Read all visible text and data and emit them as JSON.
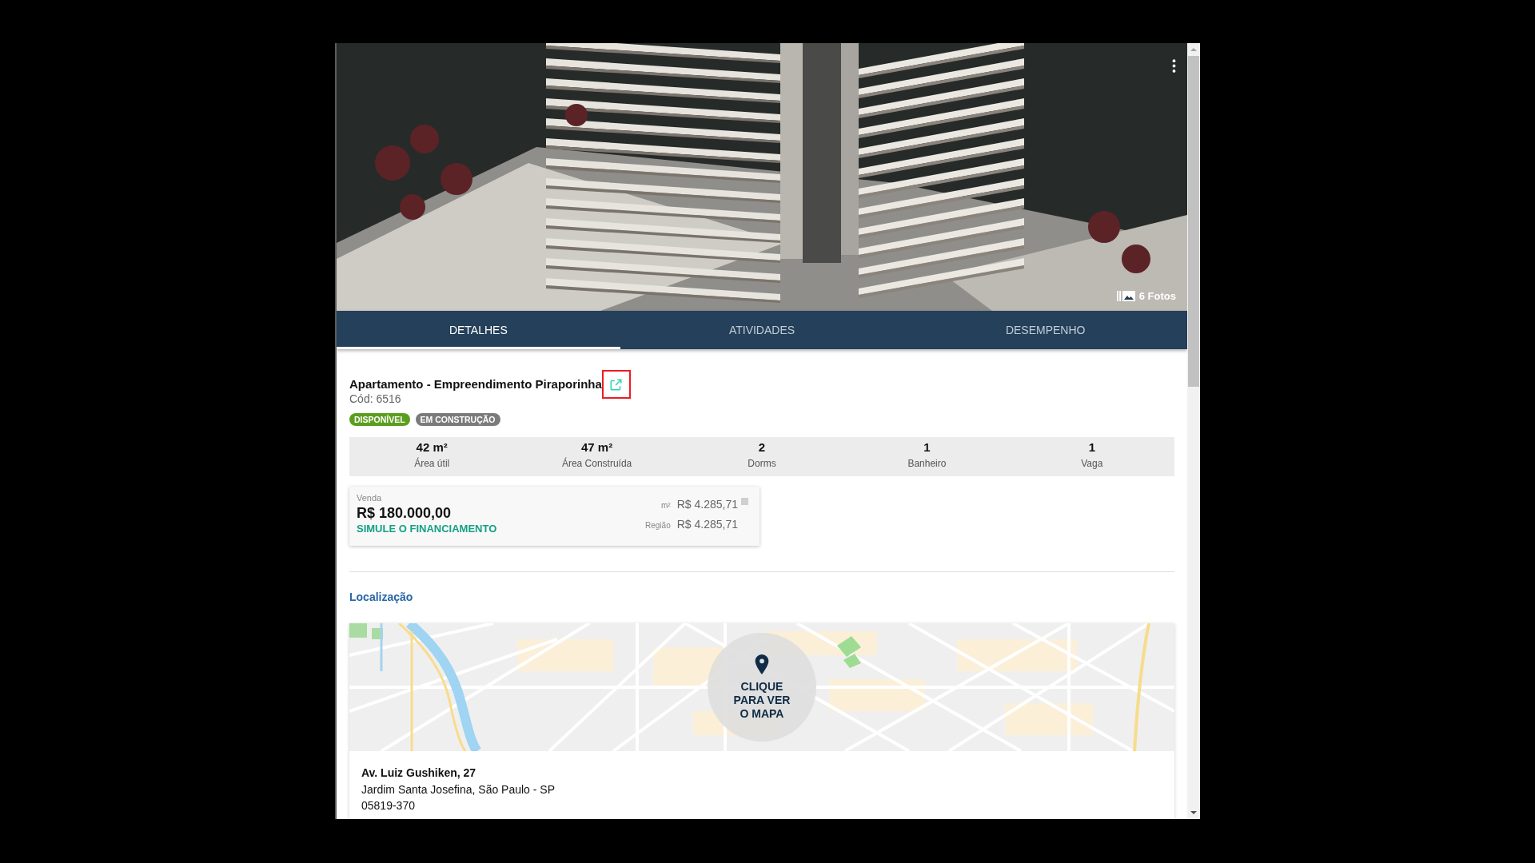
{
  "photo": {
    "count_label": "6 Fotos"
  },
  "tabs": [
    {
      "label": "DETALHES",
      "selected": true
    },
    {
      "label": "ATIVIDADES",
      "selected": false
    },
    {
      "label": "DESEMPENHO",
      "selected": false
    }
  ],
  "listing": {
    "title": "Apartamento - Empreendimento Piraporinha",
    "link_highlighted": true,
    "code": "Cód: 6516",
    "badges": [
      {
        "label": "DISPONÍVEL",
        "color": "#5b9e1f"
      },
      {
        "label": "EM CONSTRUÇÃO",
        "color": "#7b7b7b"
      }
    ]
  },
  "stats": [
    {
      "value": "42 m²",
      "label": "Área útil"
    },
    {
      "value": "47 m²",
      "label": "Área Construída"
    },
    {
      "value": "2",
      "label": "Dorms"
    },
    {
      "value": "1",
      "label": "Banheiro"
    },
    {
      "value": "1",
      "label": "Vaga"
    }
  ],
  "price": {
    "type_label": "Venda",
    "amount": "R$ 180.000,00",
    "action": "SIMULE O FINANCIAMENTO",
    "comparisons": [
      {
        "label": "m²",
        "value": "R$ 4.285,71"
      },
      {
        "label": "Região",
        "value": "R$ 4.285,71"
      }
    ]
  },
  "location": {
    "heading": "Localização",
    "map_button_lines": [
      "CLIQUE",
      "PARA VER",
      "O MAPA"
    ],
    "address": [
      "Av. Luiz Gushiken, 27",
      "Jardim Santa Josefina, São Paulo - SP",
      "05819-370"
    ]
  }
}
